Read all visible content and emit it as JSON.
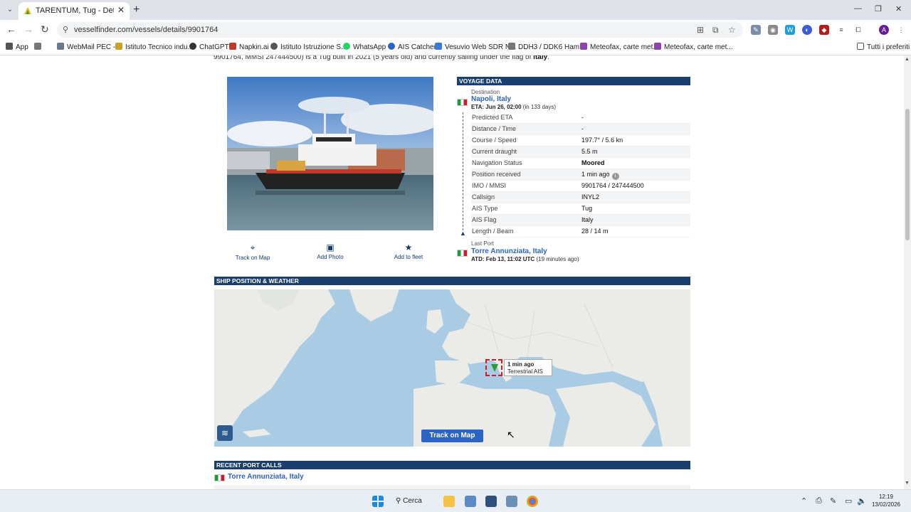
{
  "browser": {
    "tab_title": "TARENTUM, Tug - Details and c",
    "url": "vesselfinder.com/vessels/details/9901764"
  },
  "bookmarks": [
    {
      "label": "App",
      "color": "#555555"
    },
    {
      "label": "WebMail PEC -",
      "color": "#6b7a8a"
    },
    {
      "label": "Istituto Tecnico indu...",
      "color": "#c7a12a"
    },
    {
      "label": "ChatGPT",
      "color": "#333333"
    },
    {
      "label": "Napkin.ai",
      "color": "#c0392b"
    },
    {
      "label": "Istituto Istruzione S...",
      "color": "#555555"
    },
    {
      "label": "WhatsApp",
      "color": "#25d366"
    },
    {
      "label": "AIS Catcher",
      "color": "#2b63c6"
    },
    {
      "label": "Vesuvio Web SDR N...",
      "color": "#3a7bd5"
    },
    {
      "label": "DDH3 / DDK6 Ham...",
      "color": "#777777"
    },
    {
      "label": "Meteofax, carte met...",
      "color": "#8e44ad"
    },
    {
      "label": "Meteofax, carte met...",
      "color": "#8e44ad"
    },
    {
      "label": "Tutti i preferiti",
      "color": "#555555"
    }
  ],
  "intro": {
    "text": "9901764, MMSI 247444500) is a Tug built in 2021 (5 years old) and currently sailing under the flag of",
    "flag_country": "Italy"
  },
  "photo_actions": [
    {
      "label": "Track on Map",
      "icon": "map-pin-icon"
    },
    {
      "label": "Add Photo",
      "icon": "camera-icon"
    },
    {
      "label": "Add to fleet",
      "icon": "star-icon"
    }
  ],
  "voyage": {
    "title": "VOYAGE DATA",
    "destination_label": "Destination",
    "destination": "Napoli, Italy",
    "eta_label": "ETA: Jun 26, 02:00",
    "eta_note": "(in 133 days)",
    "rows": [
      {
        "key": "Predicted ETA",
        "value": "-"
      },
      {
        "key": "Distance / Time",
        "value": "-"
      },
      {
        "key": "Course / Speed",
        "value": "197.7° / 5.6 kn"
      },
      {
        "key": "Current draught",
        "value": "5.5 m"
      },
      {
        "key": "Navigation Status",
        "value": "Moored"
      },
      {
        "key": "Position received",
        "value": "1 min ago"
      },
      {
        "key": "IMO / MMSI",
        "value": "9901764 / 247444500"
      },
      {
        "key": "Callsign",
        "value": "INYL2"
      },
      {
        "key": "AIS Type",
        "value": "Tug"
      },
      {
        "key": "AIS Flag",
        "value": "Italy"
      },
      {
        "key": "Length / Beam",
        "value": "28 / 14 m"
      }
    ],
    "last_port_label": "Last Port",
    "last_port": "Torre Annunziata, Italy",
    "atd_label": "ATD: Feb 13, 11:02 UTC",
    "atd_note": "(19 minutes ago)"
  },
  "ship_position": {
    "title": "SHIP POSITION & WEATHER",
    "popup_time": "1 min ago",
    "popup_source": "Terrestrial AIS",
    "track_button": "Track on Map"
  },
  "recent_port_calls": {
    "title": "RECENT PORT CALLS",
    "port": "Torre Annunziata, Italy"
  },
  "taskbar": {
    "search_label": "Cerca",
    "time": "12:19",
    "date": "13/02/2026"
  }
}
